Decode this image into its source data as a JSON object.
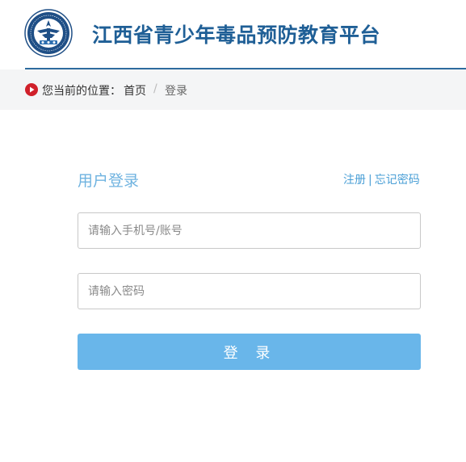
{
  "header": {
    "site_title": "江西省青少年毒品预防教育平台",
    "brand_color": "#1f5f96"
  },
  "breadcrumb": {
    "label": "您当前的位置：",
    "home": "首页",
    "separator": "/",
    "current": "登录",
    "icon": "play-circle-icon",
    "icon_color": "#d0202a"
  },
  "login": {
    "title": "用户登录",
    "register_link": "注册",
    "link_separator": "|",
    "forgot_link": "忘记密码",
    "account_placeholder": "请输入手机号/账号",
    "account_value": "",
    "password_placeholder": "请输入密码",
    "password_value": "",
    "submit_label": "登 录",
    "accent_color": "#69b6ea"
  }
}
